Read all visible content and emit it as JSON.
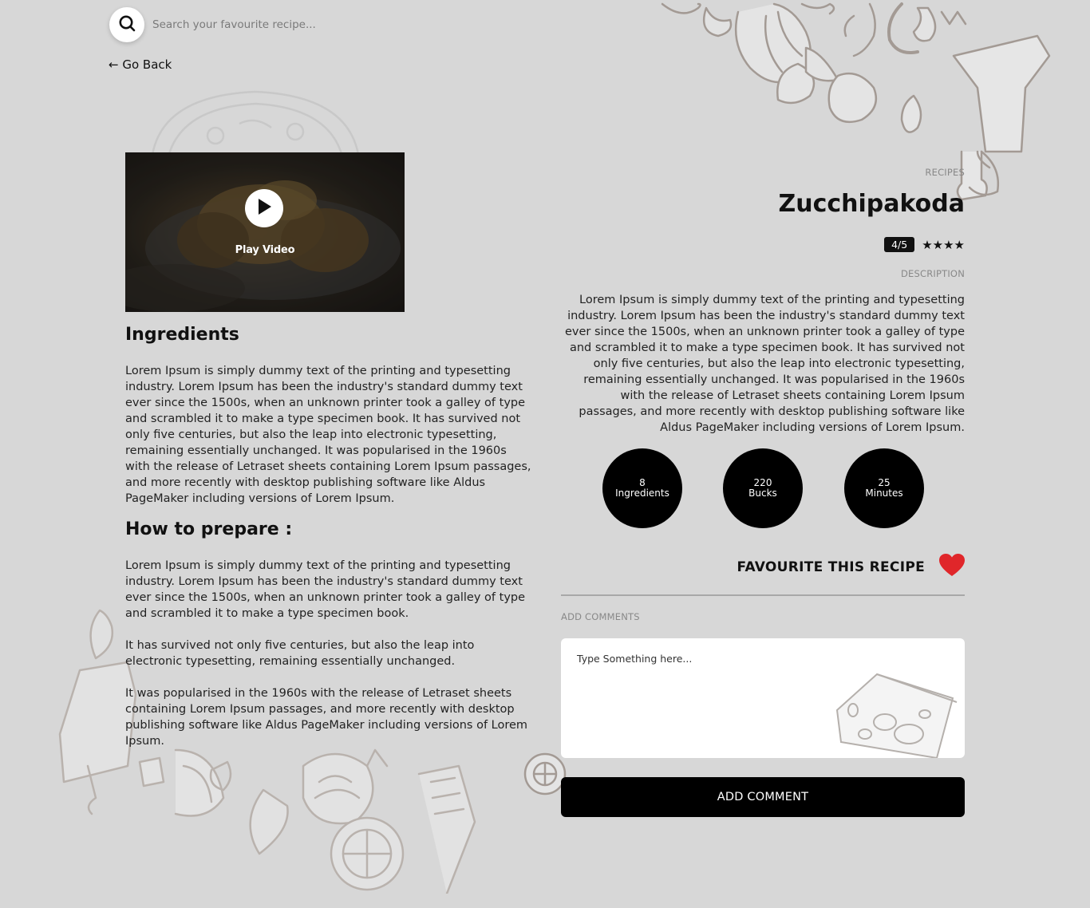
{
  "search": {
    "placeholder": "Search your favourite recipe..."
  },
  "nav": {
    "go_back": "← Go Back"
  },
  "video": {
    "play_label": "Play Video"
  },
  "ingredients": {
    "title": "Ingredients",
    "text": "Lorem Ipsum is simply dummy text of the printing and typesetting industry. Lorem Ipsum has been the industry's standard dummy text ever since the 1500s, when an unknown printer took a galley of type and scrambled it to make a type specimen book. It has survived not only five centuries, but also the leap into electronic typesetting, remaining essentially unchanged. It was popularised in the 1960s with the release of Letraset sheets containing Lorem Ipsum passages, and more recently with desktop publishing software like Aldus PageMaker including versions of Lorem Ipsum."
  },
  "prepare": {
    "title": "How to prepare :",
    "paragraphs": [
      "Lorem Ipsum is simply dummy text of the printing and typesetting industry. Lorem Ipsum has been the industry's standard dummy text ever since the 1500s, when an unknown printer took a galley of type and scrambled it to make a type specimen book.",
      "It has survived not only five centuries, but also the leap into electronic typesetting, remaining essentially unchanged.",
      "It was popularised in the 1960s with the release of Letraset sheets containing Lorem Ipsum passages, and more recently with desktop publishing software like Aldus PageMaker including versions of Lorem Ipsum."
    ]
  },
  "recipe": {
    "category_label": "RECIPES",
    "title": "Zucchipakoda",
    "rating_text": "4/5",
    "rating_value": 4,
    "rating_max": 5,
    "description_label": "DESCRIPTION",
    "description": "Lorem Ipsum is simply dummy text of the printing and typesetting industry. Lorem Ipsum has been the industry's standard dummy text ever since the 1500s, when an unknown printer took a galley of type and scrambled it to make a type specimen book. It has survived not only five centuries, but also the leap into electronic typesetting, remaining essentially unchanged. It was popularised in the 1960s with the release of Letraset sheets containing Lorem Ipsum passages, and more recently with desktop publishing software like Aldus PageMaker including versions of Lorem Ipsum."
  },
  "stats": [
    {
      "value": "8",
      "label": "Ingredients"
    },
    {
      "value": "220",
      "label": "Bucks"
    },
    {
      "value": "25",
      "label": "Minutes"
    }
  ],
  "favourite": {
    "label": "FAVOURITE THIS RECIPE",
    "heart_color": "#e0262a"
  },
  "comments": {
    "label": "ADD COMMENTS",
    "placeholder": "Type Something here...",
    "button_label": "ADD COMMENT"
  },
  "icons": {
    "search": "search-icon",
    "play": "play-icon",
    "heart": "heart-icon",
    "star": "star-icon"
  }
}
